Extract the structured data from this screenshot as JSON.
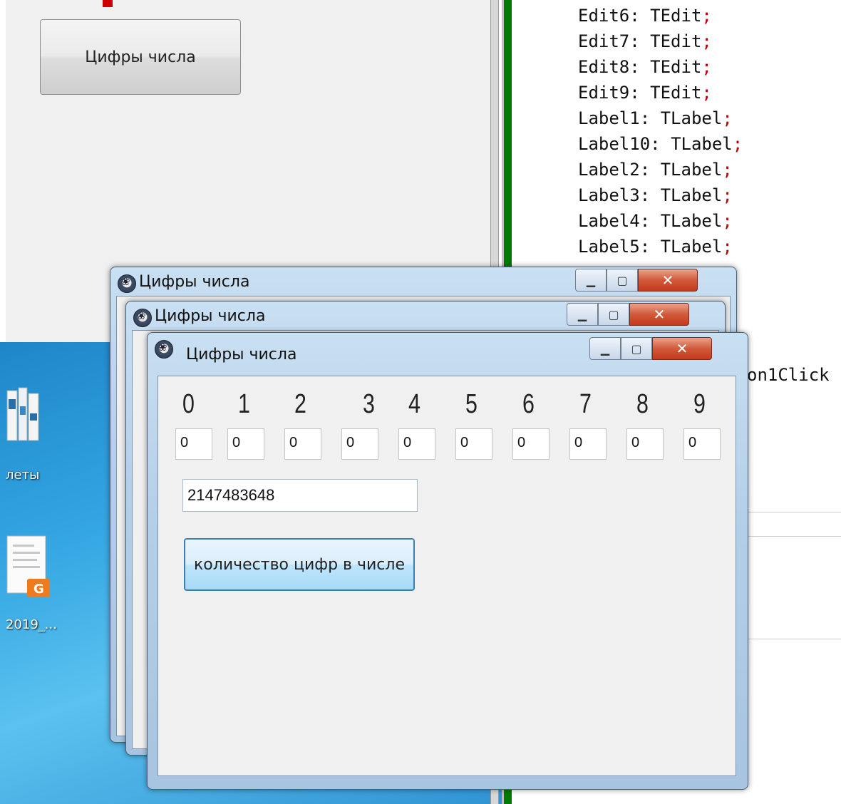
{
  "background_form": {
    "button_label": "Цифры числа"
  },
  "desktop": {
    "icons": [
      {
        "label": "леты"
      },
      {
        "label": "2019_..."
      }
    ]
  },
  "code_editor": {
    "lines": [
      {
        "name": "Edit6",
        "type": "TEdit",
        "semi": ";"
      },
      {
        "name": "Edit7",
        "type": "TEdit",
        "semi": ";"
      },
      {
        "name": "Edit8",
        "type": "TEdit",
        "semi": ";"
      },
      {
        "name": "Edit9",
        "type": "TEdit",
        "semi": ";"
      },
      {
        "name": "Label1",
        "type": "TLabel",
        "semi": ";"
      },
      {
        "name": "Label10",
        "type": "TLabel",
        "semi": ";"
      },
      {
        "name": "Label2",
        "type": "TLabel",
        "semi": ";"
      },
      {
        "name": "Label3",
        "type": "TLabel",
        "semi": ";"
      },
      {
        "name": "Label4",
        "type": "TLabel",
        "semi": ";"
      },
      {
        "name": "Label5",
        "type": "TLabel",
        "semi": ";"
      }
    ],
    "partial_text": "on1Click"
  },
  "windows": {
    "back": {
      "title": "Цифры числа"
    },
    "middle": {
      "title": "Цифры числа"
    },
    "front": {
      "title": "Цифры числа",
      "controls": {
        "minimize": "—",
        "maximize": "□",
        "close": "X"
      },
      "digit_labels": [
        "0",
        "1",
        "2",
        "3",
        "4",
        "5",
        "6",
        "7",
        "8",
        "9"
      ],
      "digit_counts": [
        "0",
        "0",
        "0",
        "0",
        "0",
        "0",
        "0",
        "0",
        "0",
        "0"
      ],
      "number_value": "2147483648",
      "count_button_label": "количество цифр в числе"
    }
  }
}
